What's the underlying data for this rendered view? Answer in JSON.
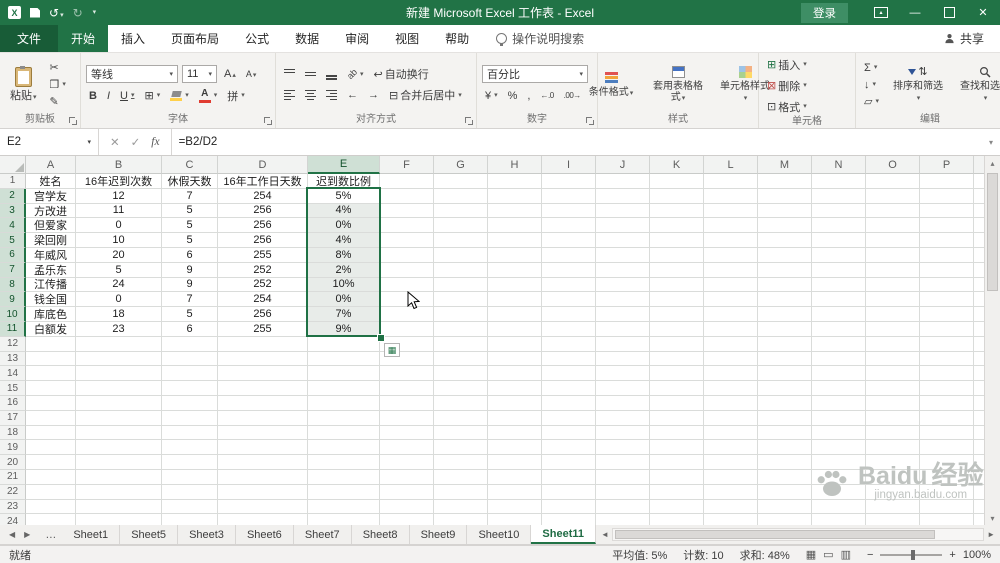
{
  "colors": {
    "accent": "#217346",
    "selection_fill": "#e8ece9",
    "header_highlight": "#cfe0d5"
  },
  "title_bar": {
    "title": "新建 Microsoft Excel 工作表 - Excel",
    "login": "登录"
  },
  "ribbon_tabs": {
    "file": "文件",
    "active": "开始",
    "others": [
      "插入",
      "页面布局",
      "公式",
      "数据",
      "审阅",
      "视图",
      "帮助"
    ],
    "tell_me": "操作说明搜索",
    "share": "共享"
  },
  "ribbon": {
    "clipboard": {
      "label": "剪贴板",
      "paste": "粘贴"
    },
    "font": {
      "label": "字体",
      "name": "等线",
      "size": "11"
    },
    "alignment": {
      "label": "对齐方式",
      "wrap": "自动换行",
      "merge": "合并后居中"
    },
    "number": {
      "label": "数字",
      "format": "百分比"
    },
    "styles": {
      "label": "样式",
      "conditional": "条件格式",
      "table": "套用表格格式",
      "cell": "单元格样式"
    },
    "cells": {
      "label": "单元格",
      "insert": "插入",
      "delete": "删除",
      "format": "格式"
    },
    "editing": {
      "label": "编辑",
      "sort": "排序和筛选",
      "find": "查找和选择"
    }
  },
  "formula_bar": {
    "name_box": "E2",
    "formula": "=B2/D2"
  },
  "sheet": {
    "columns": [
      "A",
      "B",
      "C",
      "D",
      "E",
      "F",
      "G",
      "H",
      "I",
      "J",
      "K",
      "L",
      "M",
      "N",
      "O",
      "P"
    ],
    "row_count": 24,
    "selection": {
      "range": "E2:E11",
      "column": "E",
      "row_start": 2,
      "row_end": 11
    },
    "data": {
      "headers": [
        "姓名",
        "16年迟到次数",
        "休假天数",
        "16年工作日天数",
        "迟到数比例"
      ],
      "rows": [
        [
          "宫学友",
          "12",
          "7",
          "254",
          "5%"
        ],
        [
          "方改进",
          "11",
          "5",
          "256",
          "4%"
        ],
        [
          "但爱家",
          "0",
          "5",
          "256",
          "0%"
        ],
        [
          "梁回刚",
          "10",
          "5",
          "256",
          "4%"
        ],
        [
          "年威风",
          "20",
          "6",
          "255",
          "8%"
        ],
        [
          "孟乐东",
          "5",
          "9",
          "252",
          "2%"
        ],
        [
          "江传播",
          "24",
          "9",
          "252",
          "10%"
        ],
        [
          "钱全国",
          "0",
          "7",
          "254",
          "0%"
        ],
        [
          "库底色",
          "18",
          "5",
          "256",
          "7%"
        ],
        [
          "白额发",
          "23",
          "6",
          "255",
          "9%"
        ]
      ]
    }
  },
  "sheet_tabs": {
    "nav_ellipsis": "…",
    "items": [
      "Sheet1",
      "Sheet5",
      "Sheet3",
      "Sheet6",
      "Sheet7",
      "Sheet8",
      "Sheet9",
      "Sheet10",
      "Sheet11"
    ],
    "active": "Sheet11"
  },
  "status_bar": {
    "mode": "就绪",
    "average": "平均值: 5%",
    "count": "计数: 10",
    "sum": "求和: 48%",
    "zoom": "100%"
  },
  "watermark": {
    "brand": "Baidu",
    "suffix": "经验",
    "url": "jingyan.baidu.com"
  },
  "icons": {
    "excel_logo": "X",
    "undo": "↺",
    "redo": "↻",
    "dropdown": "▾",
    "minimize": "—",
    "close": "✕",
    "ribbon_caret": "▴",
    "cancel": "✕",
    "enter": "✓",
    "fx": "fx",
    "scissors": "✂",
    "copy": "❐",
    "painter": "✎",
    "bold": "B",
    "italic": "I",
    "underline": "U",
    "borders": "⊞",
    "phonetic": "拼",
    "grow_font": "A",
    "shrink_font": "A",
    "grow_caret": "▴",
    "shrink_caret": "▾",
    "wrap": "↩",
    "merge": "⊟",
    "indent_dec": "←",
    "indent_inc": "→",
    "orientation": "ab",
    "currency": "¥",
    "percent": "%",
    "comma": ",",
    "inc_decimal": "←.0",
    "dec_decimal": ".00→",
    "autosum": "Σ",
    "fill_down": "↓",
    "clear": "▱",
    "sort_arrows": "⇅",
    "insert_cells": "⊞",
    "delete_cells": "⊠",
    "format_cells": "⊡",
    "nav_left": "◀",
    "nav_right": "▶",
    "scroll_left": "◄",
    "scroll_right": "►",
    "scroll_up": "▴",
    "scroll_down": "▾",
    "view_normal": "▦",
    "view_layout": "▭",
    "view_break": "▥",
    "zoom_out": "−",
    "zoom_in": "+",
    "quick_analysis": "▦"
  }
}
